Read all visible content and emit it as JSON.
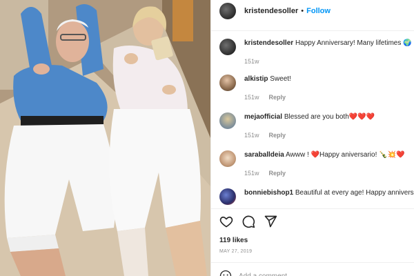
{
  "post": {
    "photo_description_icon": "photo",
    "author": "kristendesoller",
    "follow_label": "Follow",
    "caption": {
      "author": "kristendesoller",
      "text": "Happy Anniversary! Many lifetimes 🌍",
      "time": "151w"
    },
    "comments": [
      {
        "username": "alkistip",
        "text": "Sweet!",
        "time": "151w",
        "reply_label": "Reply"
      },
      {
        "username": "mejaofficial",
        "text": "Blessed are you both❤️❤️❤️",
        "time": "151w",
        "reply_label": "Reply"
      },
      {
        "username": "saraballdeia",
        "text": "Awww ! ❤️Happy aniversario! 🍾💥❤️",
        "time": "151w",
        "reply_label": "Reply"
      },
      {
        "username": "bonniebishop1",
        "text": "Beautiful at every age! Happy anniversary!",
        "time": "",
        "reply_label": ""
      }
    ],
    "likes": "119 likes",
    "date": "MAY 27, 2019",
    "add_comment_placeholder": "Add a comment..."
  },
  "icons": {
    "like": "heart-outline-icon",
    "comment": "comment-bubble-icon",
    "share": "paper-plane-icon",
    "emoji": "smiley-icon"
  },
  "colors": {
    "link_blue": "#0095f6",
    "muted": "#8e8e8e",
    "heart_red": "#ed4956"
  }
}
